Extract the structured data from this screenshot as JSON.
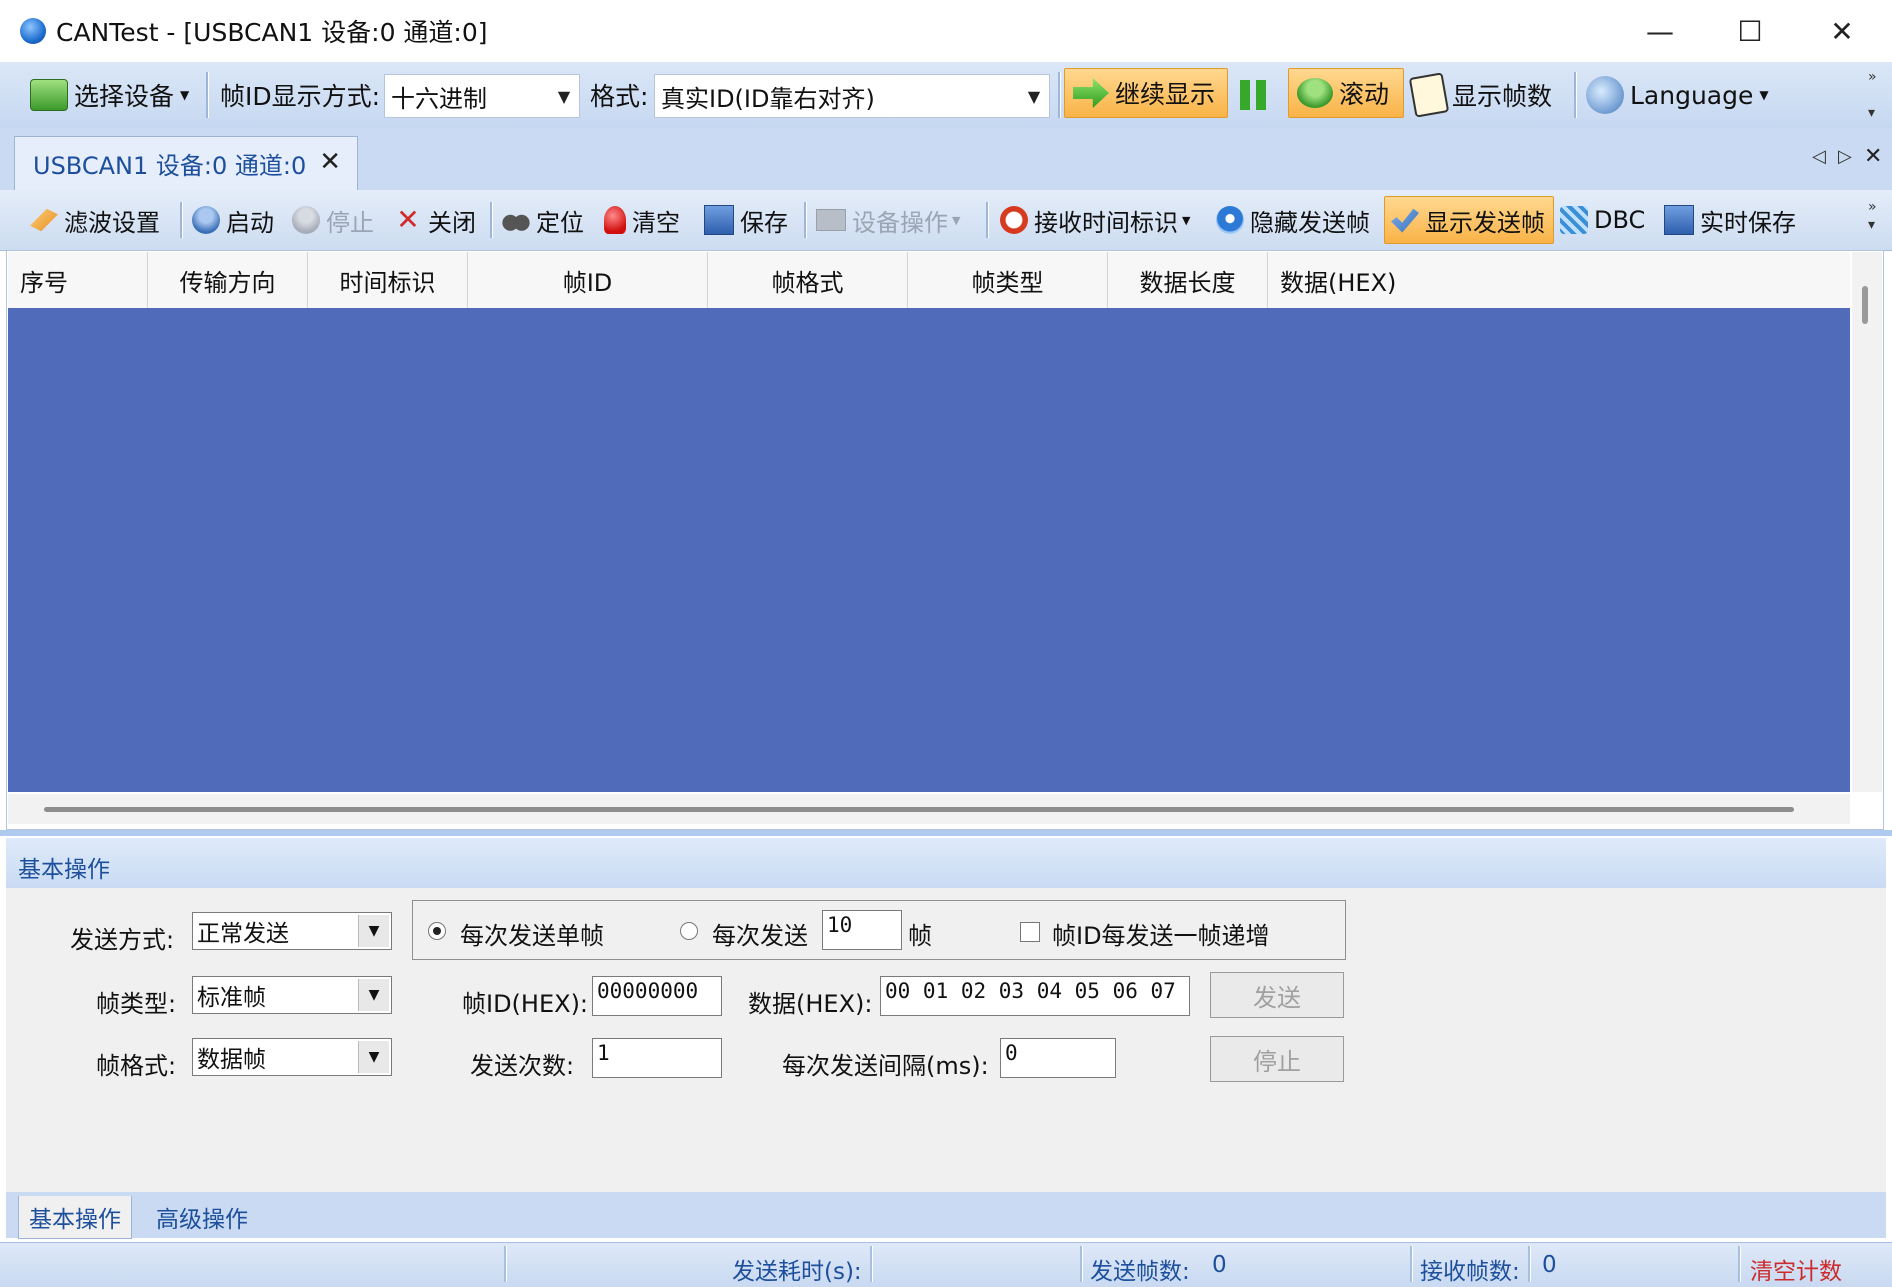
{
  "window": {
    "title": "CANTest  - [USBCAN1 设备:0 通道:0]",
    "minimize": "—",
    "maximize": "☐",
    "close": "✕"
  },
  "toolbar": {
    "select_device": "选择设备",
    "frame_id_mode_label": "帧ID显示方式:",
    "frame_id_mode_value": "十六进制",
    "format_label": "格式:",
    "format_value": "真实ID(ID靠右对齐)",
    "continue_display": "继续显示",
    "scroll": "滚动",
    "show_frame_count": "显示帧数",
    "language": "Language"
  },
  "doc_tab": {
    "label": "USBCAN1 设备:0 通道:0"
  },
  "toolbar2": {
    "filter": "滤波设置",
    "start": "启动",
    "stop": "停止",
    "close": "关闭",
    "locate": "定位",
    "clear": "清空",
    "save": "保存",
    "device_op": "设备操作",
    "recv_time": "接收时间标识",
    "hide_send": "隐藏发送帧",
    "show_send": "显示发送帧",
    "dbc": "DBC",
    "realtime_save": "实时保存"
  },
  "grid": {
    "columns": [
      "序号",
      "传输方向",
      "时间标识",
      "帧ID",
      "帧格式",
      "帧类型",
      "数据长度",
      "数据(HEX)"
    ]
  },
  "panel": {
    "title": "基本操作",
    "send_mode_label": "发送方式:",
    "send_mode_value": "正常发送",
    "frame_type_label": "帧类型:",
    "frame_type_value": "标准帧",
    "frame_format_label": "帧格式:",
    "frame_format_value": "数据帧",
    "radio_single": "每次发送单帧",
    "radio_multi": "每次发送",
    "multi_count": "10",
    "frame_unit": "帧",
    "increment_id": "帧ID每发送一帧递增",
    "frame_id_label": "帧ID(HEX):",
    "frame_id_value": "00000000",
    "data_label": "数据(HEX):",
    "data_value": "00 01 02 03 04 05 06 07",
    "send_button": "发送",
    "send_times_label": "发送次数:",
    "send_times_value": "1",
    "interval_label": "每次发送间隔(ms):",
    "interval_value": "0",
    "stop_button": "停止"
  },
  "bottom_tabs": [
    "基本操作",
    "高级操作"
  ],
  "status": {
    "send_time_label": "发送耗时(s):",
    "send_count_label": "发送帧数:",
    "send_count_value": "0",
    "recv_count_label": "接收帧数:",
    "recv_count_value": "0",
    "clear_count": "清空计数"
  }
}
